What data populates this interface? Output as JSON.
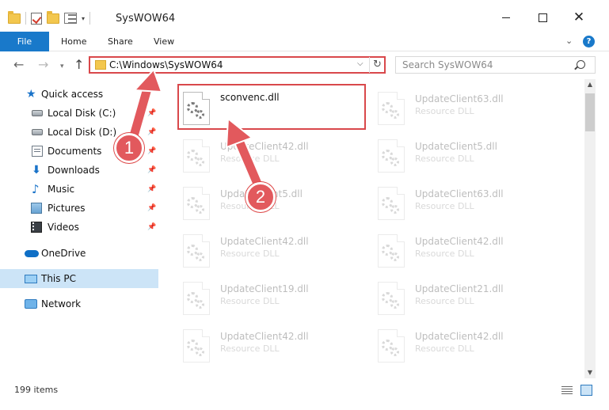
{
  "window": {
    "title": "SysWOW64"
  },
  "ribbon": {
    "tabs": [
      "File",
      "Home",
      "Share",
      "View"
    ]
  },
  "navigation": {
    "address": "C:\\Windows\\SysWOW64",
    "search_placeholder": "Search SysWOW64"
  },
  "sidebar": {
    "items": [
      {
        "label": "Quick access",
        "icon": "star-icon",
        "pinned": false
      },
      {
        "label": "Local Disk (C:)",
        "icon": "drive-icon",
        "pinned": true
      },
      {
        "label": "Local Disk (D:)",
        "icon": "drive-icon",
        "pinned": true
      },
      {
        "label": "Documents",
        "icon": "documents-icon",
        "pinned": true
      },
      {
        "label": "Downloads",
        "icon": "downloads-icon",
        "pinned": true
      },
      {
        "label": "Music",
        "icon": "music-icon",
        "pinned": true
      },
      {
        "label": "Pictures",
        "icon": "pictures-icon",
        "pinned": true
      },
      {
        "label": "Videos",
        "icon": "videos-icon",
        "pinned": true
      },
      {
        "label": "OneDrive",
        "icon": "onedrive-icon",
        "pinned": false
      },
      {
        "label": "This PC",
        "icon": "pc-icon",
        "pinned": false,
        "selected": true
      },
      {
        "label": "Network",
        "icon": "network-icon",
        "pinned": false
      }
    ]
  },
  "files": [
    {
      "name": "sconvenc.dll",
      "type": "",
      "highlighted": true
    },
    {
      "name": "UpdateClient63.dll",
      "type": "Resource DLL"
    },
    {
      "name": "UpdateClient42.dll",
      "type": "Resource DLL"
    },
    {
      "name": "UpdateClient5.dll",
      "type": "Resource DLL"
    },
    {
      "name": "UpdateClient5.dll",
      "type": "Resource DLL"
    },
    {
      "name": "UpdateClient63.dll",
      "type": "Resource DLL"
    },
    {
      "name": "UpdateClient42.dll",
      "type": "Resource DLL"
    },
    {
      "name": "UpdateClient42.dll",
      "type": "Resource DLL"
    },
    {
      "name": "UpdateClient19.dll",
      "type": "Resource DLL"
    },
    {
      "name": "UpdateClient21.dll",
      "type": "Resource DLL"
    },
    {
      "name": "UpdateClient42.dll",
      "type": "Resource DLL"
    },
    {
      "name": "UpdateClient42.dll",
      "type": "Resource DLL"
    }
  ],
  "status": {
    "item_count": "199 items"
  },
  "annotations": {
    "step1": "1",
    "step2": "2",
    "color": "#e2595d"
  }
}
